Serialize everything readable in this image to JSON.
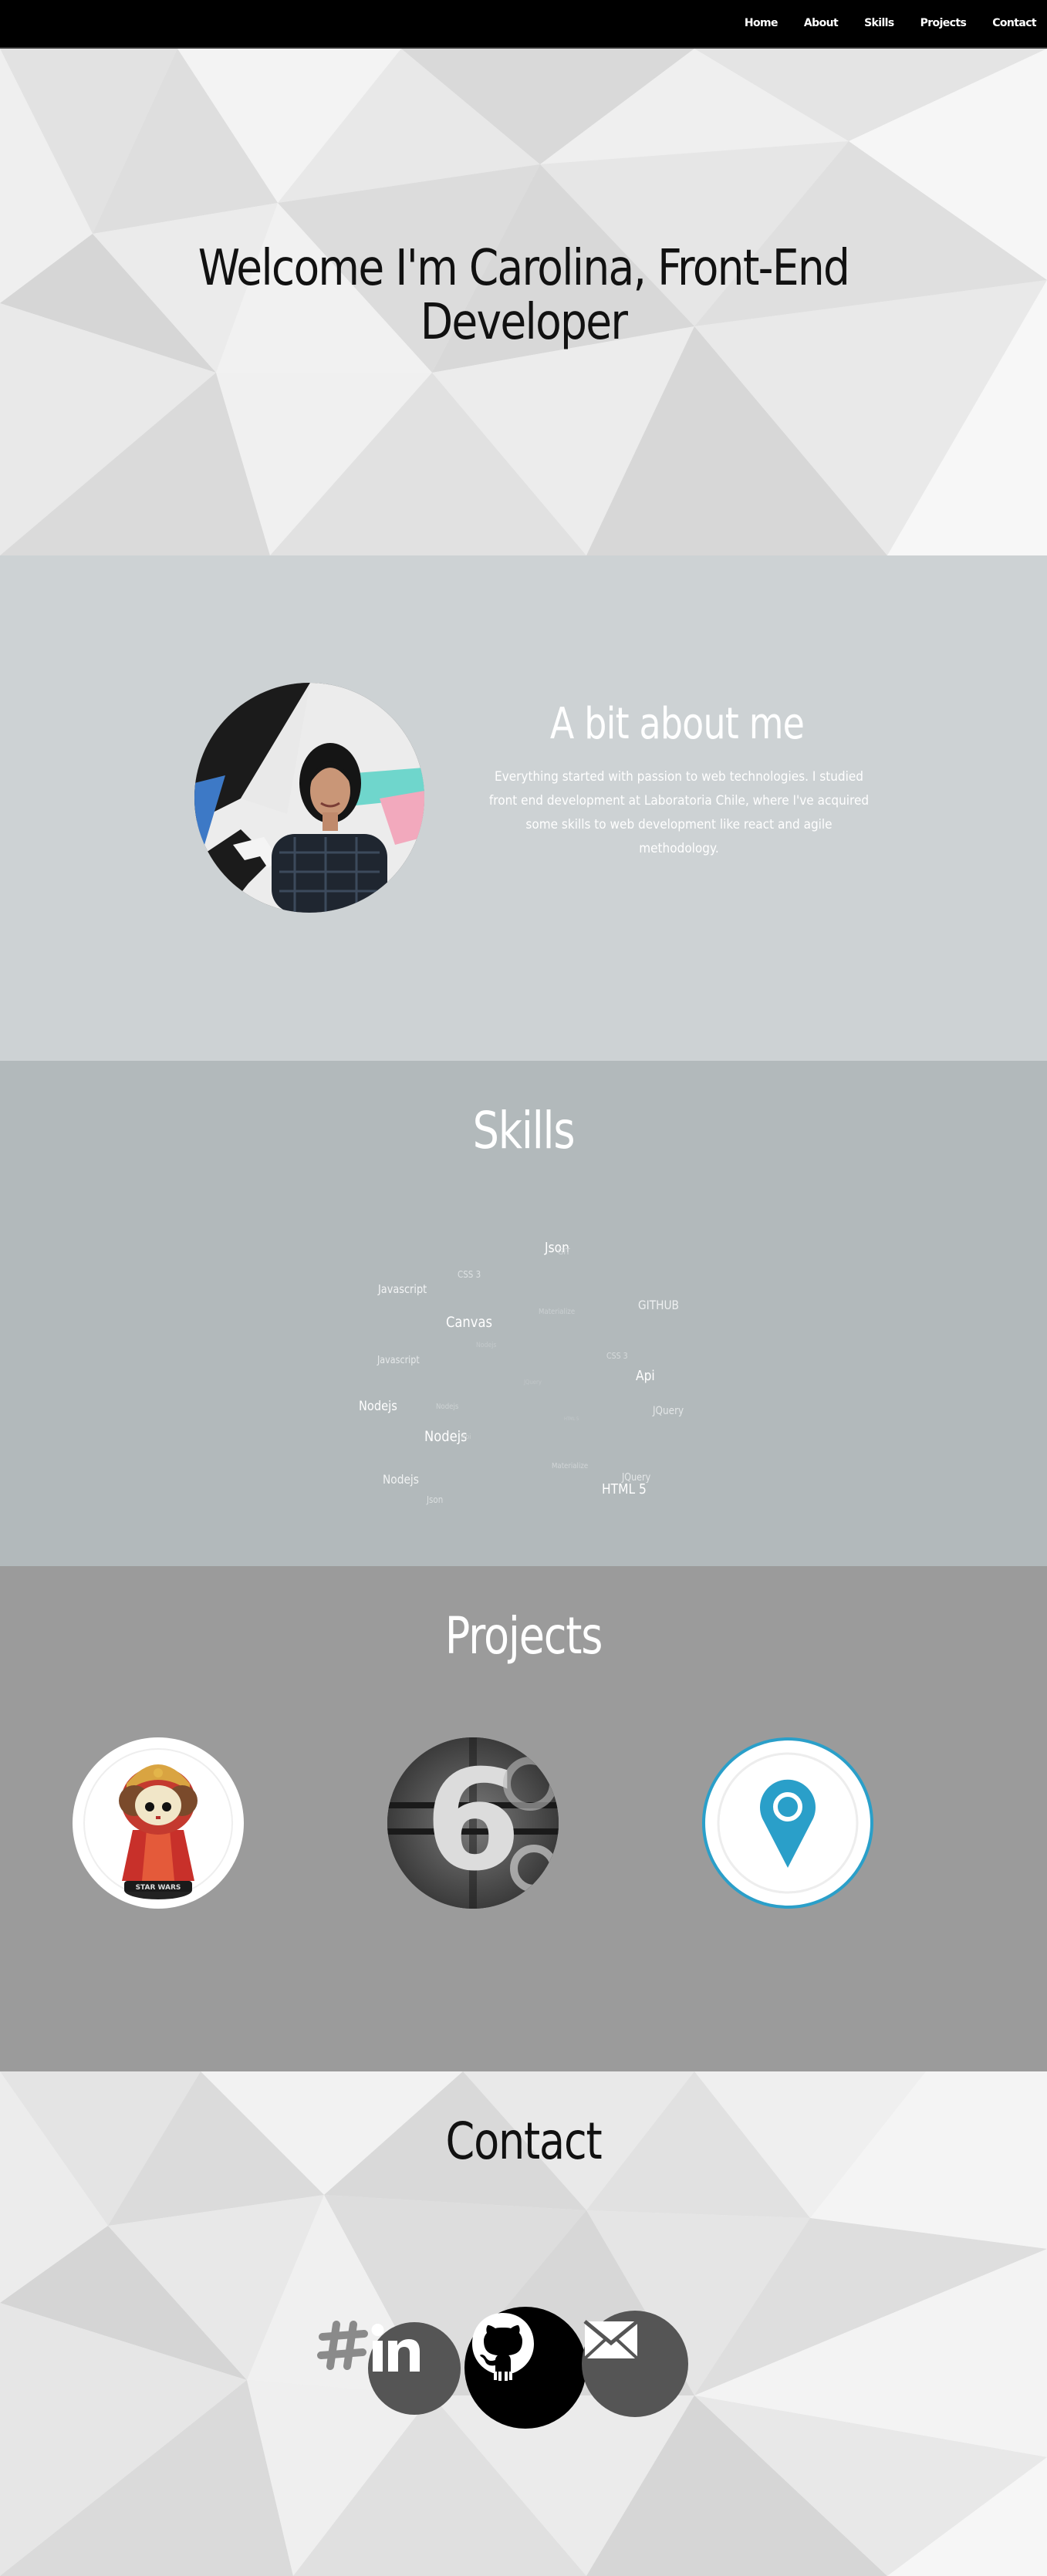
{
  "nav": {
    "items": [
      "Home",
      "About",
      "Skills",
      "Projects",
      "Contact"
    ]
  },
  "hero": {
    "title_line1": "Welcome I'm Carolina, Front-End",
    "title_line2": "Developer"
  },
  "about": {
    "title": "A bit about me",
    "text": "Everything started with passion to web technologies. I studied front end development at Laboratoria Chile, where I've acquired some skills to web development like react and agile methodology."
  },
  "skills": {
    "title": "Skills",
    "cloud": [
      "Json",
      "GIT",
      "CSS 3",
      "Javascript",
      "GITHUB",
      "Canvas",
      "Materialize",
      "Nodejs",
      "Javascript",
      "CSS 3",
      "Api",
      "JQuery",
      "Nodejs",
      "Nodejs",
      "JQuery",
      "HTML 5",
      "Nodejs",
      "Api",
      "Materialize",
      "Nodejs",
      "JQuery",
      "HTML 5",
      "Json"
    ]
  },
  "projects": {
    "title": "Projects",
    "items": [
      "amidala-funko-project",
      "countdown-six-project",
      "map-pin-project"
    ]
  },
  "contact": {
    "title": "Contact",
    "icons": [
      "slack-icon",
      "linkedin-icon",
      "github-icon",
      "mail-icon"
    ]
  },
  "colors": {
    "nav_bg": "#000000",
    "about_bg": "#cdd2d4",
    "skills_bg": "#b2b9bb",
    "projects_bg": "#9b9b9b",
    "pin_blue": "#2a9fc9"
  }
}
